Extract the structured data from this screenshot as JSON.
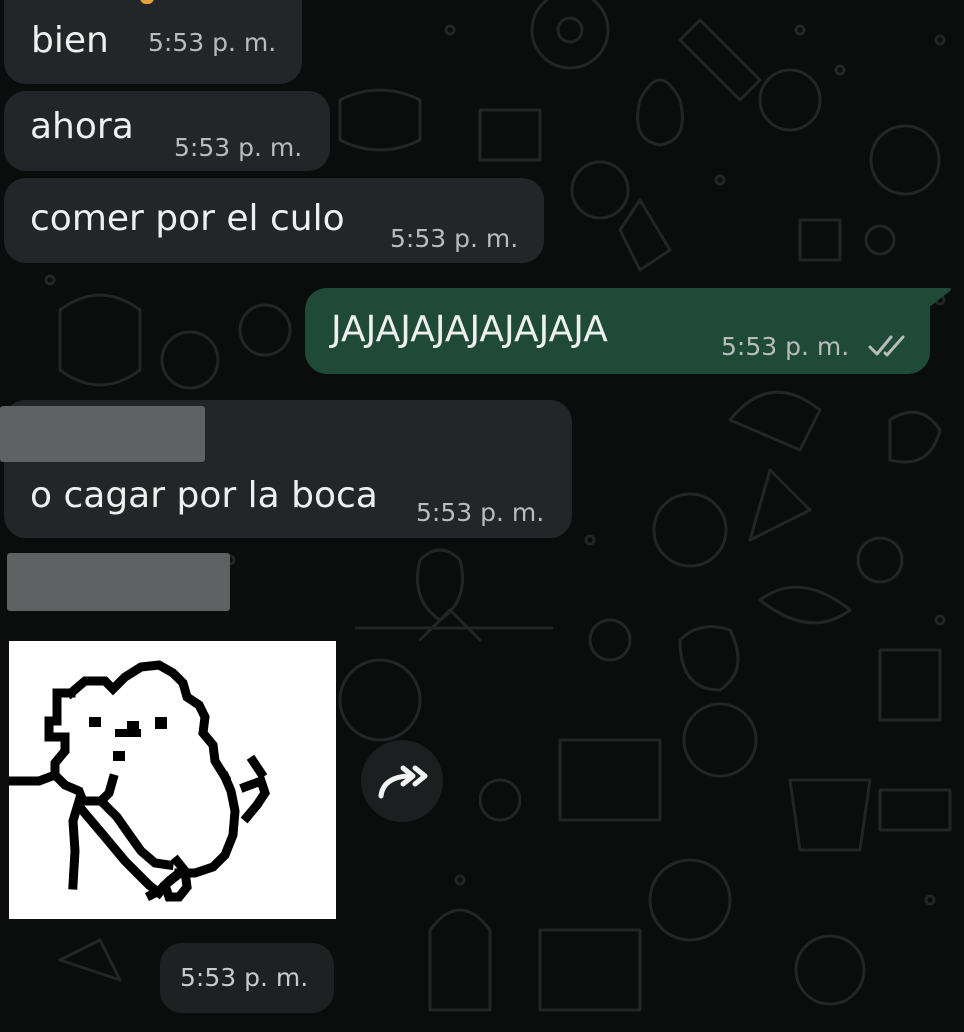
{
  "theme": {
    "background": "#0b0c0c",
    "incoming_bubble": "#232628",
    "outgoing_bubble": "#1f4a38",
    "text": "#eef0f0",
    "timestamp": "#b8bcbd"
  },
  "messages": [
    {
      "direction": "in",
      "text": "bien",
      "time": "5:53 p. m."
    },
    {
      "direction": "in",
      "text": "ahora",
      "time": "5:53 p. m."
    },
    {
      "direction": "in",
      "text": "comer por el culo",
      "time": "5:53 p. m."
    },
    {
      "direction": "out",
      "text": "JAJAJAJAJAJAJAJA",
      "time": "5:53 p. m.",
      "status_icon": "double-check-icon"
    },
    {
      "direction": "in",
      "text": "o cagar por la boca",
      "time": "5:53 p. m.",
      "sender_redacted": true
    },
    {
      "direction": "in",
      "type": "sticker",
      "sticker_description": "line drawing of a bear/hamster",
      "time": "5:53 p. m.",
      "sender_redacted": true,
      "action_icon": "forward-icon"
    }
  ]
}
